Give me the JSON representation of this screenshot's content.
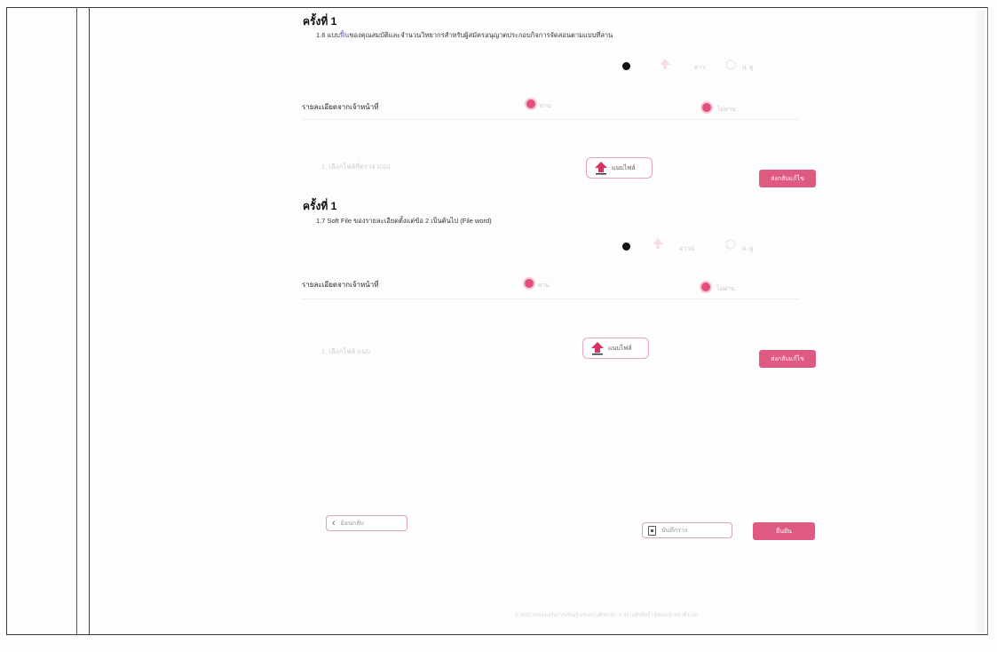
{
  "section1": {
    "title": "ครั้งที่ 1",
    "subtitle_main": "1.6 แบบ",
    "subtitle_highlight": "ฟื้น",
    "subtitle_rest": "ของคุณสมบัติและจำนวนวิทยากรสำหรับผู้สมัครอนุญาตประกอบกิจการจัดสอนตามแบบที่ลาน",
    "icon_hint_1": "ดาว",
    "icon_hint_2": "ฝ. ดู",
    "detail_label": "รายละเอียดจากเจ้าหน้าที่",
    "radio_1_label": "ผ่าน",
    "radio_2_label": "ไม่ผ่าน",
    "file_hint": "1. เลือกไฟล์ที่ตรวจ แนบ",
    "upload_label": "แนบไฟล์",
    "send_label": "ส่งกลับแก้ไข"
  },
  "section2": {
    "title": "ครั้งที่ 1",
    "subtitle": "1.7 Soft File ของรายละเอียดตั้งแต่ข้อ 2 เป็นต้นไป (File word)",
    "icon_hint_1": "ดาวน์",
    "icon_hint_2": "ฝ. ดู",
    "detail_label": "รายละเอียดจากเจ้าหน้าที่",
    "radio_1_label": "ผ่าน",
    "radio_2_label": "ไม่ผ่าน",
    "file_hint": "1. เลือกไฟล์ แนบ",
    "upload_label": "แนบไฟล์",
    "send_label": "ส่งกลับแก้ไข"
  },
  "footer": {
    "back_label": "ย้อนกลับ",
    "save_label": "บันทึกร่าง",
    "submit_label": "ยืนยัน",
    "copyright": "© 2023 กรมส่งเสริมการเรียนรู้ กระทรวงศึกษาธิการ สงวนลิขสิทธิ์ | ติดต่อเจ้าหน้าที่ระบบ"
  },
  "colors": {
    "accent": "#de5a80",
    "accent_border": "#e4a5b5"
  }
}
